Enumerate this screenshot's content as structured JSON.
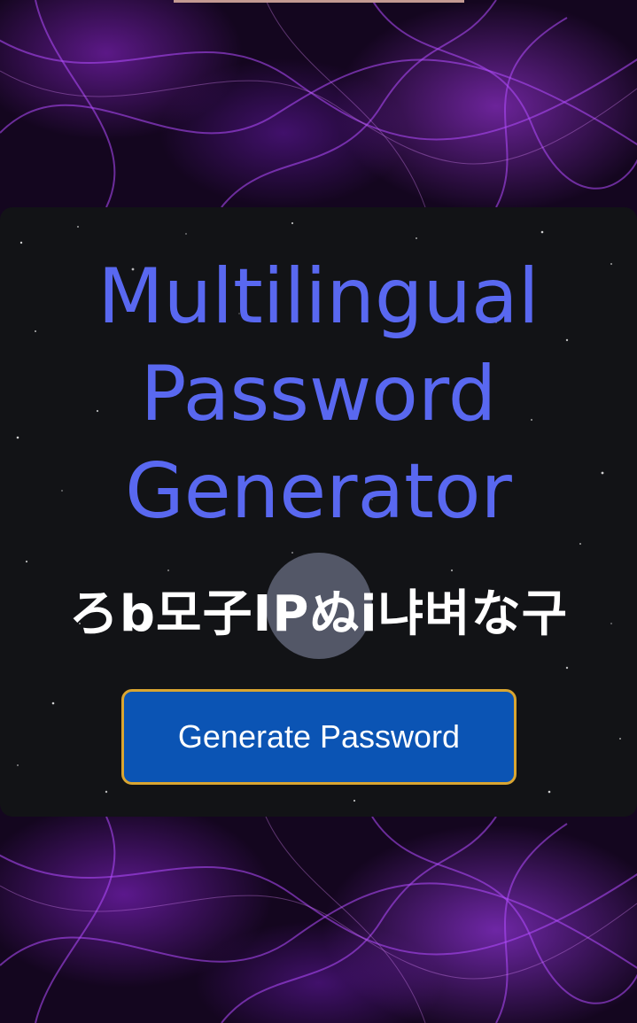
{
  "app": {
    "title": "Multilingual Password Generator",
    "generated_password": "ろb모子IPぬi냐벼な구",
    "generate_button_label": "Generate Password"
  },
  "colors": {
    "title": "#5968f0",
    "button_bg": "#0b54b4",
    "button_border": "#d9a531",
    "card_bg": "#121316",
    "background_accent": "#a030ff"
  }
}
